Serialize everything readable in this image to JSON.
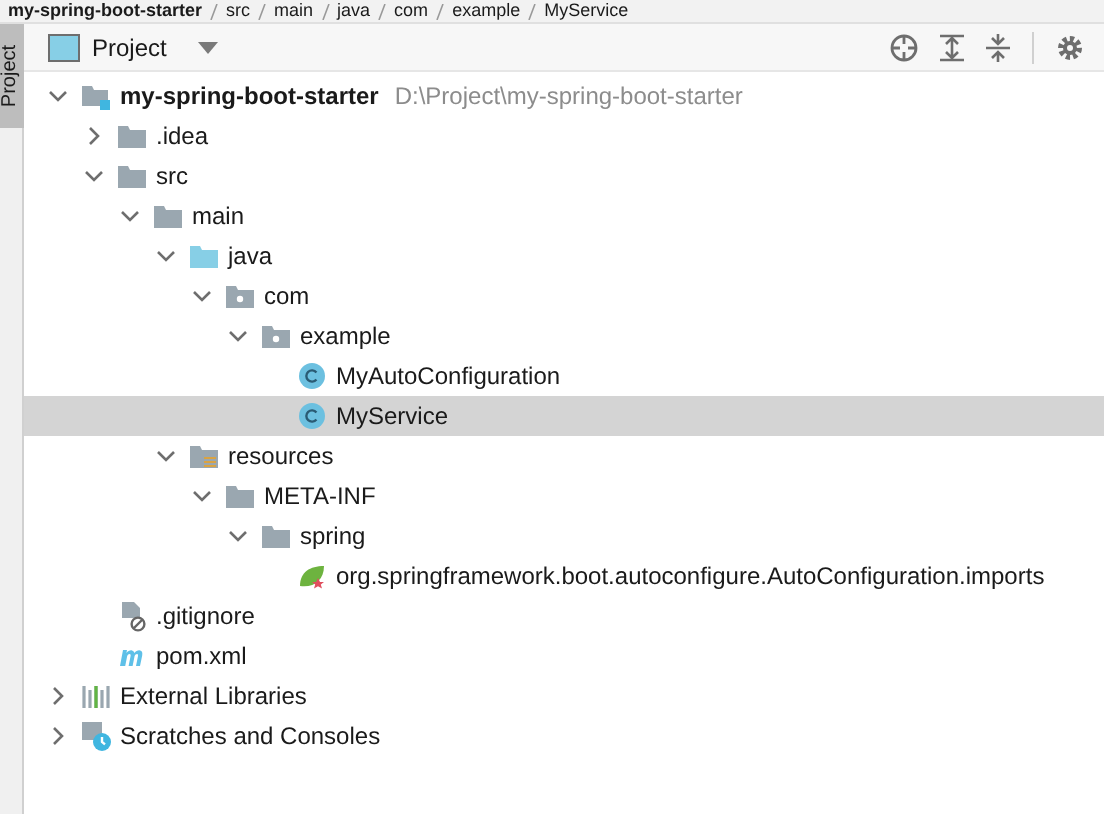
{
  "breadcrumb": [
    "my-spring-boot-starter",
    "src",
    "main",
    "java",
    "com",
    "example",
    "MyService"
  ],
  "side_tab": {
    "label": "Project"
  },
  "toolbar": {
    "view_label": "Project"
  },
  "tree": [
    {
      "kind": "project",
      "label": "my-spring-boot-starter",
      "path": "D:\\Project\\my-spring-boot-starter",
      "expanded": true,
      "selected": false,
      "children": [
        {
          "kind": "folder",
          "label": ".idea",
          "expanded": false,
          "selected": false
        },
        {
          "kind": "folder",
          "label": "src",
          "expanded": true,
          "selected": false,
          "children": [
            {
              "kind": "folder",
              "label": "main",
              "expanded": true,
              "selected": false,
              "children": [
                {
                  "kind": "source",
                  "label": "java",
                  "expanded": true,
                  "selected": false,
                  "children": [
                    {
                      "kind": "package",
                      "label": "com",
                      "expanded": true,
                      "selected": false,
                      "children": [
                        {
                          "kind": "package",
                          "label": "example",
                          "expanded": true,
                          "selected": false,
                          "children": [
                            {
                              "kind": "class",
                              "label": "MyAutoConfiguration",
                              "selected": false
                            },
                            {
                              "kind": "class",
                              "label": "MyService",
                              "selected": true
                            }
                          ]
                        }
                      ]
                    }
                  ]
                },
                {
                  "kind": "resources",
                  "label": "resources",
                  "expanded": true,
                  "selected": false,
                  "children": [
                    {
                      "kind": "folder",
                      "label": "META-INF",
                      "expanded": true,
                      "selected": false,
                      "children": [
                        {
                          "kind": "folder",
                          "label": "spring",
                          "expanded": true,
                          "selected": false,
                          "children": [
                            {
                              "kind": "spring",
                              "label": "org.springframework.boot.autoconfigure.AutoConfiguration.imports",
                              "selected": false
                            }
                          ]
                        }
                      ]
                    }
                  ]
                }
              ]
            }
          ]
        },
        {
          "kind": "ignore",
          "label": ".gitignore",
          "selected": false
        },
        {
          "kind": "maven",
          "label": "pom.xml",
          "selected": false
        }
      ]
    },
    {
      "kind": "libraries",
      "label": "External Libraries",
      "expanded": false,
      "selected": false
    },
    {
      "kind": "scratches",
      "label": "Scratches and Consoles",
      "expanded": false,
      "selected": false
    }
  ]
}
